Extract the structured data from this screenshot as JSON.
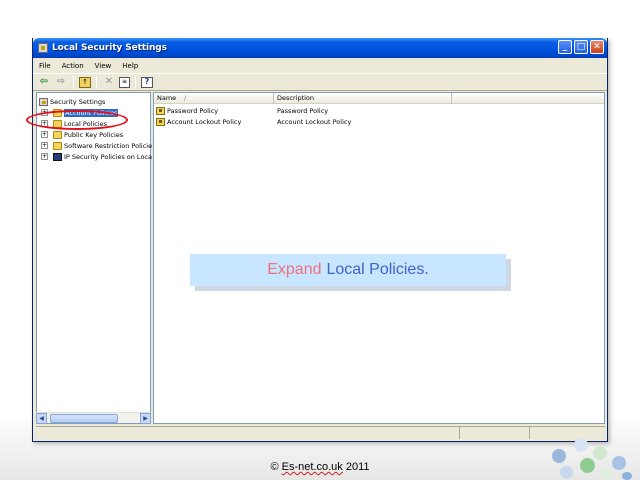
{
  "window": {
    "title": "Local Security Settings",
    "buttons": {
      "minimize": "_",
      "maximize": "□",
      "close": "✕"
    }
  },
  "menu": [
    "File",
    "Action",
    "View",
    "Help"
  ],
  "toolbar": {
    "icons": [
      "back-icon",
      "forward-icon",
      "up-folder-icon",
      "delete-icon",
      "properties-icon",
      "help-icon"
    ]
  },
  "tree": {
    "root": "Security Settings",
    "items": [
      {
        "label": "Account Policies",
        "state": "selected"
      },
      {
        "label": "Local Policies"
      },
      {
        "label": "Public Key Policies"
      },
      {
        "label": "Software Restriction Policie"
      },
      {
        "label": "IP Security Policies on Loca"
      }
    ]
  },
  "list": {
    "columns": [
      "Name",
      "Description"
    ],
    "sort_indicator": "/",
    "rows": [
      {
        "name": "Password Policy",
        "description": "Password Policy"
      },
      {
        "name": "Account Lockout Policy",
        "description": "Account Lockout Policy"
      }
    ]
  },
  "callout": {
    "part1": "Expand",
    "part2": "Local Policies."
  },
  "footer": {
    "prefix": "© ",
    "domain": "Es-net.co.uk",
    "year": " 2011"
  },
  "colors": {
    "highlight_ellipse": "#e0101a",
    "callout_bg": "#c8e6ff",
    "callout_word1": "#f07080",
    "callout_word2": "#3f63c8"
  }
}
